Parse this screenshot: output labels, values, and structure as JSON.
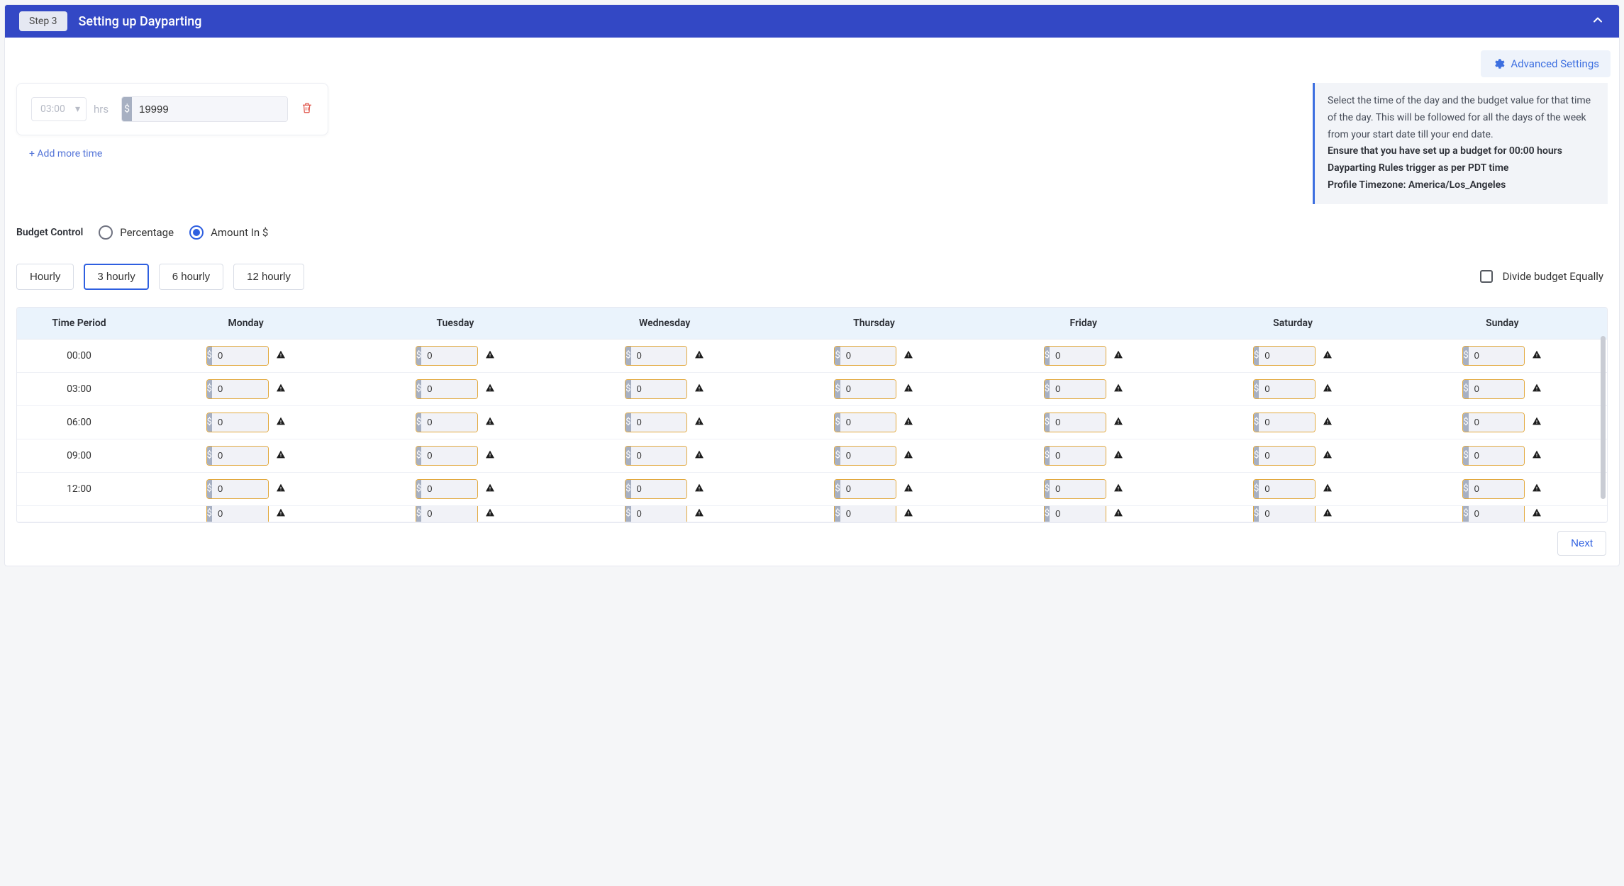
{
  "banner": {
    "step_label": "Step 3",
    "title": "Setting up Dayparting"
  },
  "advanced_settings_label": "Advanced Settings",
  "time_card": {
    "time_value": "03:00",
    "hrs_label": "hrs",
    "currency_symbol": "$",
    "amount_value": "19999"
  },
  "add_more_label": "+ Add more time",
  "info": {
    "line1": "Select the time of the day and the budget value for that time of the day. This will be followed for all the days of the week from your start date till your end date.",
    "line2": "Ensure that you have set up a budget for 00:00 hours",
    "line3": "Dayparting Rules trigger as per PDT time",
    "line4": "Profile Timezone: America/Los_Angeles"
  },
  "budget_control": {
    "label": "Budget Control",
    "option_percentage": "Percentage",
    "option_amount": "Amount In $",
    "selected": "amount"
  },
  "frequency": {
    "options": [
      "Hourly",
      "3 hourly",
      "6 hourly",
      "12 hourly"
    ],
    "active_index": 1
  },
  "divide_equally_label": "Divide budget Equally",
  "table": {
    "time_header": "Time Period",
    "days": [
      "Monday",
      "Tuesday",
      "Wednesday",
      "Thursday",
      "Friday",
      "Saturday",
      "Sunday"
    ],
    "rows": [
      {
        "time": "00:00",
        "vals": [
          "0",
          "0",
          "0",
          "0",
          "0",
          "0",
          "0"
        ]
      },
      {
        "time": "03:00",
        "vals": [
          "0",
          "0",
          "0",
          "0",
          "0",
          "0",
          "0"
        ]
      },
      {
        "time": "06:00",
        "vals": [
          "0",
          "0",
          "0",
          "0",
          "0",
          "0",
          "0"
        ]
      },
      {
        "time": "09:00",
        "vals": [
          "0",
          "0",
          "0",
          "0",
          "0",
          "0",
          "0"
        ]
      },
      {
        "time": "12:00",
        "vals": [
          "0",
          "0",
          "0",
          "0",
          "0",
          "0",
          "0"
        ]
      }
    ],
    "currency_symbol": "$"
  },
  "next_label": "Next"
}
